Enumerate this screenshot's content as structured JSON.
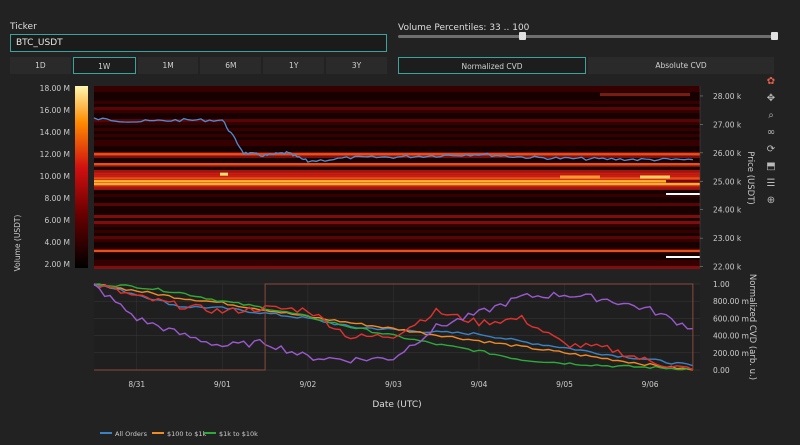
{
  "ticker": {
    "label": "Ticker",
    "value": "BTC_USDT"
  },
  "volume": {
    "label": "Volume Percentiles: 33 .. 100",
    "low": 33,
    "high": 100
  },
  "timeframes": [
    {
      "label": "1D",
      "active": false
    },
    {
      "label": "1W",
      "active": true
    },
    {
      "label": "1M",
      "active": false
    },
    {
      "label": "6M",
      "active": false
    },
    {
      "label": "1Y",
      "active": false
    },
    {
      "label": "3Y",
      "active": false
    }
  ],
  "cvd_modes": [
    {
      "label": "Normalized CVD",
      "active": true
    },
    {
      "label": "Absolute CVD",
      "active": false
    }
  ],
  "toolbar": [
    "plotly-logo-icon",
    "pan-icon",
    "zoom-icon",
    "lasso-icon",
    "autoscale-icon",
    "download-icon",
    "hover-compare-icon",
    "spike-lines-icon"
  ],
  "chart_data": [
    {
      "type": "heatmap",
      "colorbar_label": "Volume (USDT)",
      "colorbar_ticks": [
        "18.00 M",
        "16.00 M",
        "14.00 M",
        "12.00 M",
        "10.00 M",
        "8.00 M",
        "6.00 M",
        "4.00 M",
        "2.00 M"
      ],
      "ylabel": "Price (USDT)",
      "y_ticks": [
        "28.00 k",
        "27.00 k",
        "26.00 k",
        "25.00 k",
        "24.00 k",
        "23.00 k",
        "22.00 k"
      ],
      "ylim": [
        21950,
        28350
      ],
      "price_line": {
        "x": [
          "2023-08-30 12:00",
          "2023-08-31 00:00",
          "2023-08-31 12:00",
          "2023-09-01 00:00",
          "2023-09-01 06:00",
          "2023-09-01 12:00",
          "2023-09-01 18:00",
          "2023-09-02 00:00",
          "2023-09-02 12:00",
          "2023-09-03 00:00",
          "2023-09-03 12:00",
          "2023-09-04 00:00",
          "2023-09-04 12:00",
          "2023-09-05 00:00",
          "2023-09-05 12:00",
          "2023-09-06 00:00",
          "2023-09-06 12:00"
        ],
        "y": [
          27200,
          27100,
          27150,
          27150,
          26000,
          25900,
          26000,
          25700,
          25830,
          25850,
          25900,
          25950,
          25850,
          25800,
          25780,
          25760,
          25760
        ]
      },
      "strong_levels": [
        25950,
        25600,
        25100,
        25000,
        24900,
        22550
      ]
    },
    {
      "type": "line",
      "xlabel": "Date (UTC)",
      "ylabel": "Normalized CVD (arb. u.)",
      "x_ticks": [
        "8/31",
        "9/01",
        "9/02",
        "9/03",
        "9/04",
        "9/05",
        "9/06"
      ],
      "y_ticks": [
        "0.00",
        "200.00 m",
        "400.00 m",
        "600.00 m",
        "800.00 m",
        "1.00"
      ],
      "ylim": [
        0,
        1
      ],
      "x": [
        "2023-08-30 12:00",
        "2023-08-31 00:00",
        "2023-08-31 12:00",
        "2023-09-01 00:00",
        "2023-09-01 12:00",
        "2023-09-02 00:00",
        "2023-09-02 12:00",
        "2023-09-03 00:00",
        "2023-09-03 12:00",
        "2023-09-04 00:00",
        "2023-09-04 12:00",
        "2023-09-05 00:00",
        "2023-09-05 12:00",
        "2023-09-06 00:00",
        "2023-09-06 12:00"
      ],
      "series": [
        {
          "name": "All Orders",
          "color": "#3b82c4",
          "values": [
            1.0,
            0.88,
            0.74,
            0.72,
            0.66,
            0.6,
            0.5,
            0.47,
            0.44,
            0.42,
            0.33,
            0.26,
            0.18,
            0.12,
            0.05
          ]
        },
        {
          "name": "$100 to $1k",
          "color": "#f08a24",
          "values": [
            1.0,
            0.92,
            0.84,
            0.78,
            0.7,
            0.62,
            0.55,
            0.48,
            0.41,
            0.34,
            0.27,
            0.2,
            0.13,
            0.06,
            0.0
          ]
        },
        {
          "name": "$1k to $10k",
          "color": "#2eaa3a",
          "values": [
            1.0,
            0.97,
            0.9,
            0.8,
            0.72,
            0.62,
            0.5,
            0.4,
            0.3,
            0.22,
            0.12,
            0.08,
            0.05,
            0.03,
            0.01
          ]
        },
        {
          "name": "",
          "color": "#e0322e",
          "values": [
            1.0,
            0.85,
            0.75,
            0.68,
            0.72,
            0.7,
            0.38,
            0.4,
            0.68,
            0.55,
            0.6,
            0.3,
            0.25,
            0.1,
            0.0
          ]
        },
        {
          "name": "",
          "color": "#9b59d0",
          "values": [
            0.98,
            0.6,
            0.42,
            0.28,
            0.32,
            0.15,
            0.12,
            0.14,
            0.5,
            0.66,
            0.85,
            0.88,
            0.82,
            0.7,
            0.48
          ]
        },
        {
          "name": "",
          "color": "#8b4a3e",
          "values": [
            0.0,
            0.0,
            0.0,
            0.0,
            1.0,
            1.0,
            1.0,
            1.0,
            1.0,
            1.0,
            1.0,
            1.0,
            1.0,
            1.0,
            0.0
          ]
        }
      ]
    }
  ]
}
